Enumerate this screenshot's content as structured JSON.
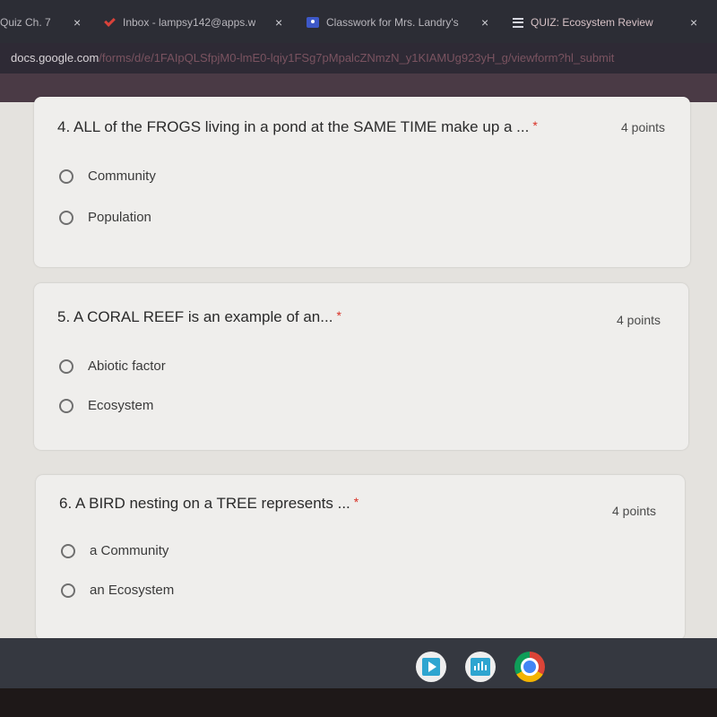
{
  "browser": {
    "tabs": [
      {
        "title": "Quiz Ch. 7",
        "icon": "doc-icon",
        "active": false
      },
      {
        "title": "Inbox - lampsy142@apps.w",
        "icon": "gmail-icon",
        "active": false
      },
      {
        "title": "Classwork for Mrs. Landry's",
        "icon": "classroom-icon",
        "active": false
      },
      {
        "title": "QUIZ: Ecosystem Review",
        "icon": "forms-icon",
        "active": true
      }
    ],
    "close_glyph": "×",
    "url_domain": "docs.google.com",
    "url_path": "/forms/d/e/1FAIpQLSfpjM0-lmE0-lqiy1FSg7pMpalcZNmzN_y1KIAMUg923yH_g/viewform?hl_submit"
  },
  "form": {
    "required_marker": "*",
    "questions": [
      {
        "number": "4.",
        "text": "ALL of the FROGS living in a pond at the SAME TIME make up a ...",
        "points": "4 points",
        "options": [
          "Community",
          "Population"
        ]
      },
      {
        "number": "5.",
        "text": "A CORAL REEF is an example of an...",
        "points": "4 points",
        "options": [
          "Abiotic factor",
          "Ecosystem"
        ]
      },
      {
        "number": "6.",
        "text": "A BIRD nesting on a TREE represents ...",
        "points": "4 points",
        "options": [
          "a Community",
          "an Ecosystem"
        ]
      }
    ]
  },
  "shelf": {
    "apps": [
      {
        "name": "play-app-icon"
      },
      {
        "name": "audio-wave-app-icon"
      },
      {
        "name": "chrome-icon"
      }
    ]
  }
}
